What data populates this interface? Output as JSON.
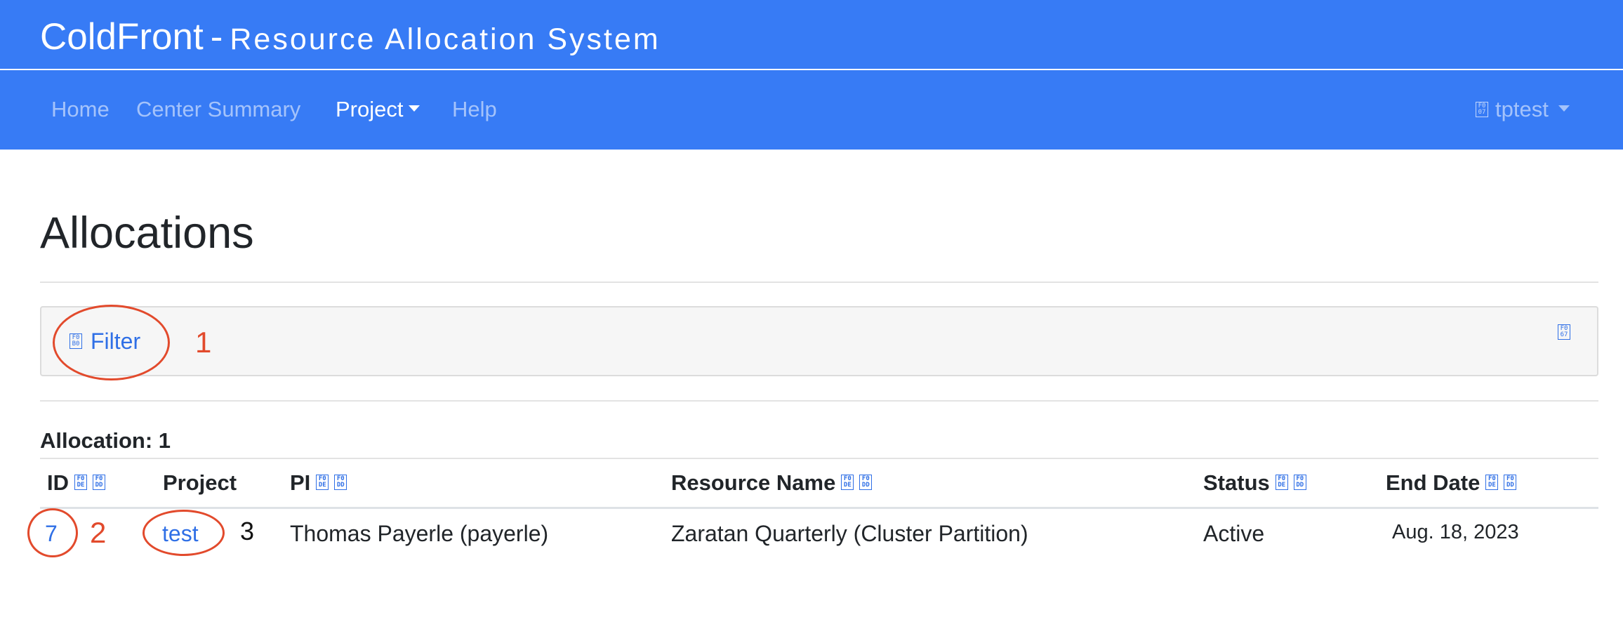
{
  "header": {
    "app_name": "ColdFront",
    "separator": "-",
    "subtitle": "Resource Allocation System",
    "background_color": "#377bf5"
  },
  "nav": {
    "items": [
      {
        "label": "Home",
        "active": false
      },
      {
        "label": "Center Summary",
        "active": false
      },
      {
        "label": "Project",
        "active": true,
        "dropdown": true
      },
      {
        "label": "Help",
        "active": false
      }
    ],
    "user": {
      "icon": "user-icon",
      "glyph": "F0 07",
      "name": "tptest",
      "dropdown": true
    }
  },
  "main": {
    "title": "Allocations",
    "filter": {
      "icon": "filter-icon",
      "icon_glyph": "F0 B0",
      "label": "Filter",
      "expand_icon_glyph": "F0 67"
    },
    "count_label": "Allocation: 1",
    "table": {
      "sort_icon_glyphs": [
        "F0 DE",
        "F0 DD"
      ],
      "columns": [
        "ID",
        "Project",
        "PI",
        "Resource Name",
        "Status",
        "End Date"
      ],
      "rows": [
        {
          "id": "7",
          "project": "test",
          "pi": "Thomas Payerle (payerle)",
          "resource": "Zaratan Quarterly (Cluster Partition)",
          "status": "Active",
          "end_date": "Aug. 18, 2023"
        }
      ]
    }
  },
  "annotations": {
    "color": "#e24a2c",
    "labels": [
      "1",
      "2",
      "3"
    ]
  }
}
